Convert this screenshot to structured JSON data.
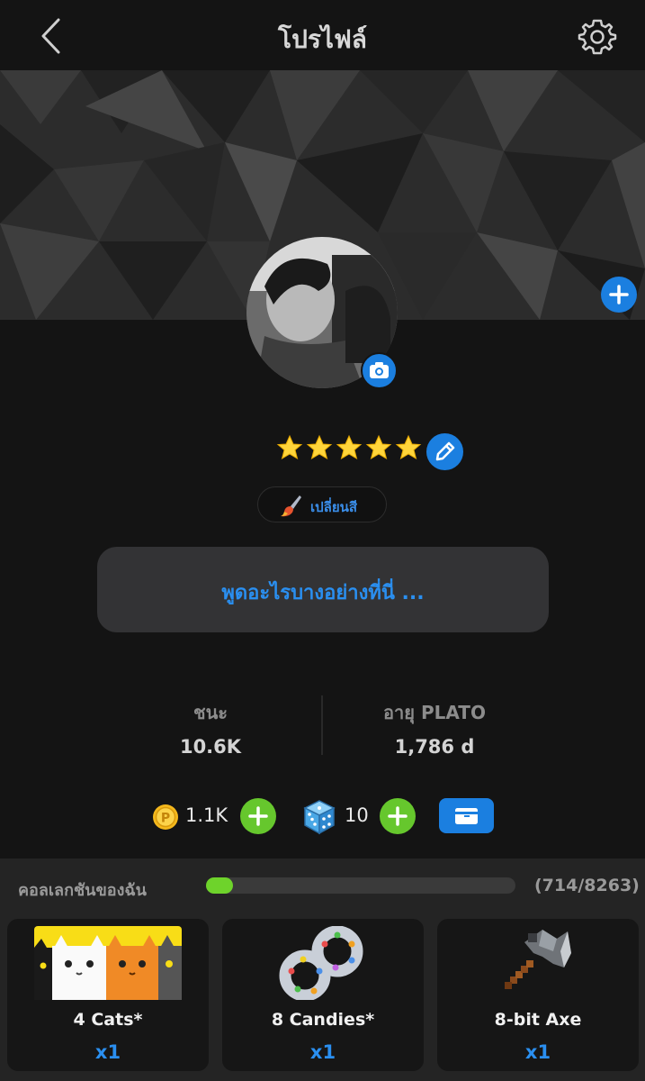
{
  "header": {
    "title": "โปรไฟล์",
    "back_icon": "chevron-left-icon",
    "settings_icon": "gear-icon"
  },
  "profile": {
    "rating_stars": 5,
    "change_color_label": "เปลี่ยนสี",
    "status_placeholder": "พูดอะไรบางอย่างที่นี่ ..."
  },
  "stats": {
    "wins_label": "ชนะ",
    "wins_value": "10.6K",
    "age_label": "อายุ PLATO",
    "age_value": "1,786 d"
  },
  "currency": {
    "coins_value": "1.1K",
    "dice_value": "10"
  },
  "collection": {
    "title": "คอลเลกชันของฉัน",
    "count": "(714/8263)",
    "progress_fraction": 0.0864,
    "items": [
      {
        "name": "4 Cats*",
        "qty": "x1"
      },
      {
        "name": "8 Candies*",
        "qty": "x1"
      },
      {
        "name": "8-bit Axe",
        "qty": "x1"
      }
    ]
  },
  "colors": {
    "accent_blue": "#1b7fe0",
    "accent_green": "#66c72d",
    "link_blue": "#2a8ff0"
  }
}
